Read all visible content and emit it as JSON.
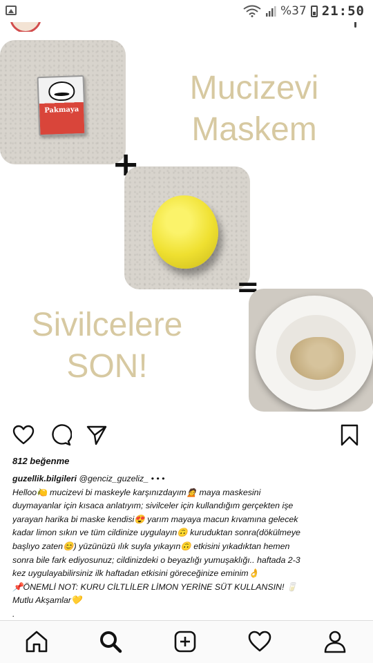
{
  "status_bar": {
    "battery_percent": "%37",
    "time": "21:50",
    "icons": [
      "gallery-icon",
      "wifi-icon",
      "signal-icon",
      "battery-icon"
    ]
  },
  "post": {
    "image": {
      "title_line1": "Mucizevi",
      "title_line2": "Maskem",
      "slogan_line1": "Sivilcelere",
      "slogan_line2": "SON!",
      "plus_symbol": "+",
      "equals_symbol": "=",
      "yeast_brand": "Pakmaya",
      "text_color": "#d7c9a1"
    },
    "likes_text": "812 beğenme",
    "caption": {
      "username": "guzellik.bilgileri",
      "mention": " @genciz_guzeliz_ • • •",
      "lines": [
        "Helloo🍋 mucizevi bi maskeyle karşınızdayım🙍 maya maskesini",
        "duymayanlar için kısaca anlatıyım; sivilceler için kullandığım gerçekten işe",
        "yarayan harika bi maske kendisi😍 yarım mayaya macun kıvamına gelecek",
        "kadar limon sıkın ve tüm cildinize uygulayın🙃 kuruduktan sonra(dökülmeye",
        "başlıyo zaten😊) yüzünüzü ılık suyla yıkayın🙃 etkisini yıkadıktan hemen",
        "sonra bile fark ediyosunuz; cildinizdeki o beyazlığı yumuşaklığı.. haftada 2-3",
        "kez uygulayabilirsiniz ilk haftadan etkisini göreceğinize eminim👌",
        "📌ÖNEMLİ NOT: KURU CİLTLİLER LİMON YERİNE SÜT KULLANSIN! 🥛",
        "Mutlu Akşamlar💛"
      ],
      "trailing": "."
    }
  },
  "actions": [
    "heart-icon",
    "comment-icon",
    "share-icon",
    "bookmark-icon"
  ],
  "bottom_nav": [
    "home-icon",
    "search-icon",
    "add-post-icon",
    "activity-heart-icon",
    "profile-icon"
  ]
}
